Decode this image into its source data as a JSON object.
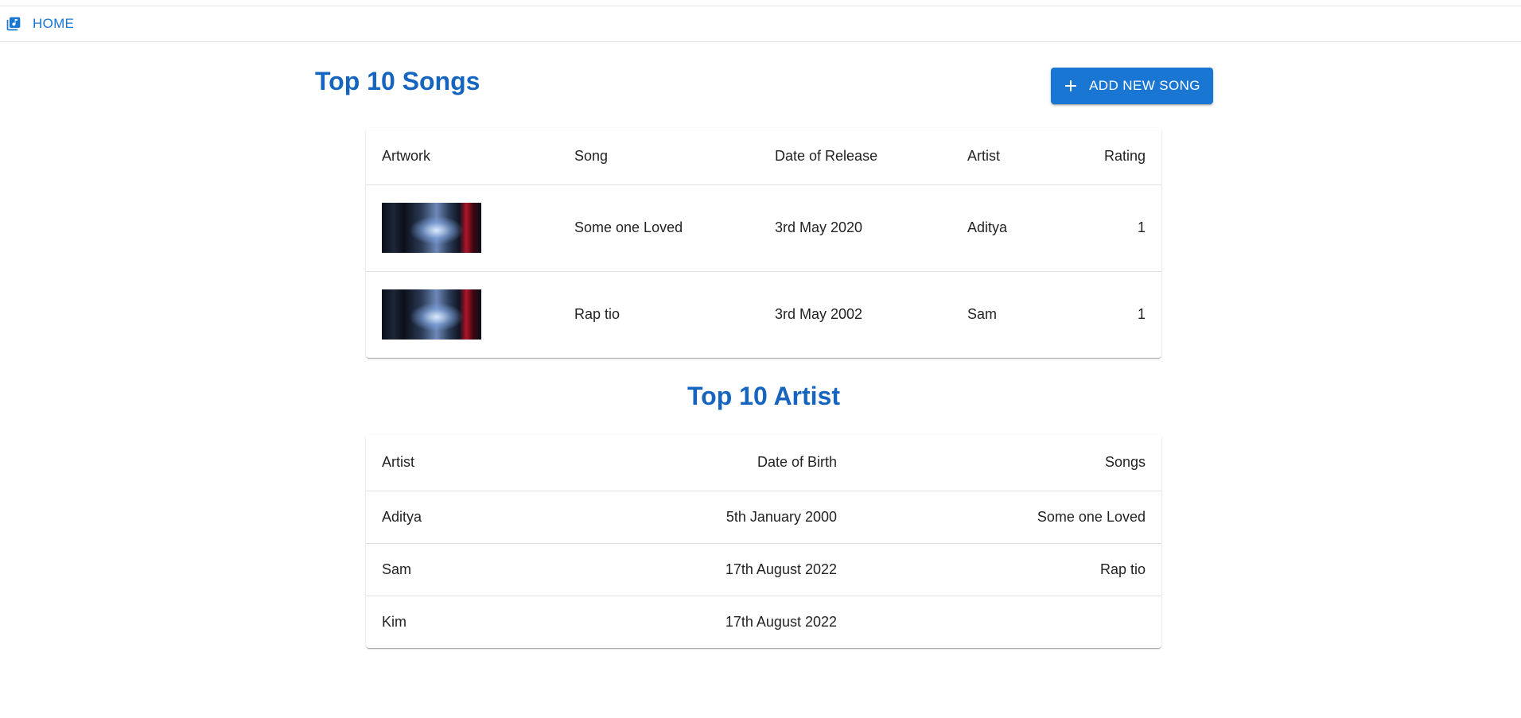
{
  "colors": {
    "primary": "#1976d2",
    "title": "#1565c0",
    "divider": "#e0e0e0"
  },
  "nav": {
    "home_label": "HOME",
    "icon": "music-library-icon"
  },
  "songs": {
    "title": "Top 10 Songs",
    "add_button_label": "ADD NEW SONG",
    "add_icon": "plus-icon",
    "columns": [
      "Artwork",
      "Song",
      "Date of Release",
      "Artist",
      "Rating"
    ],
    "rows": [
      {
        "song": "Some one Loved",
        "release": "3rd May 2020",
        "artist": "Aditya",
        "rating": "1"
      },
      {
        "song": "Rap tio",
        "release": "3rd May 2002",
        "artist": "Sam",
        "rating": "1"
      }
    ]
  },
  "artists": {
    "title": "Top 10 Artist",
    "columns": [
      "Artist",
      "Date of Birth",
      "Songs"
    ],
    "rows": [
      {
        "artist": "Aditya",
        "dob": "5th January 2000",
        "songs": "Some one Loved"
      },
      {
        "artist": "Sam",
        "dob": "17th August 2022",
        "songs": "Rap tio"
      },
      {
        "artist": "Kim",
        "dob": "17th August 2022",
        "songs": ""
      }
    ]
  }
}
